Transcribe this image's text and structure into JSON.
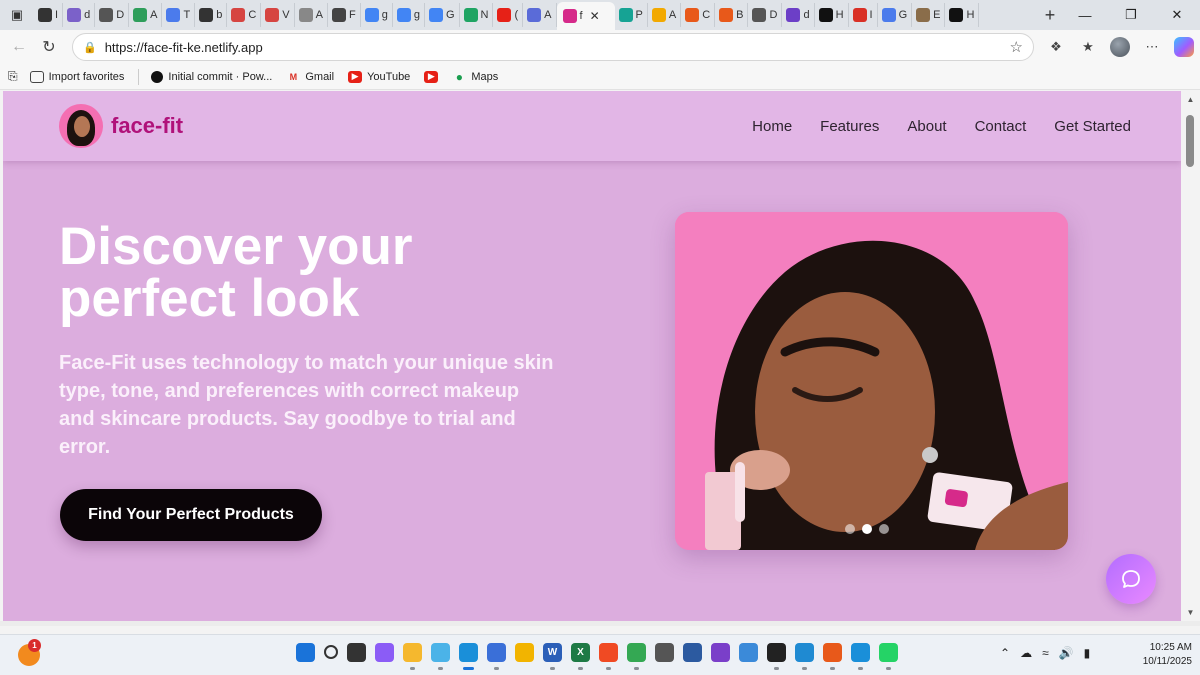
{
  "browser": {
    "active_tab": {
      "title": "f",
      "favicon_color": "#d62a8a"
    },
    "tab_favicons": [
      {
        "label": "I",
        "color": "#333333",
        "icon": "github-icon"
      },
      {
        "label": "d",
        "color": "#7b61c9",
        "icon": "doc-icon"
      },
      {
        "label": "D",
        "color": "#555555",
        "icon": "sparkle-icon"
      },
      {
        "label": "A",
        "color": "#2e9e5b",
        "icon": "sheet-icon"
      },
      {
        "label": "T",
        "color": "#4b7bec",
        "icon": "docs-icon"
      },
      {
        "label": "b",
        "color": "#333333",
        "icon": "github-icon"
      },
      {
        "label": "C",
        "color": "#d64541",
        "icon": "pdf-icon"
      },
      {
        "label": "V",
        "color": "#d64541",
        "icon": "pdf-icon"
      },
      {
        "label": "A",
        "color": "#888888",
        "icon": "globe-icon"
      },
      {
        "label": "F",
        "color": "#444444",
        "icon": "openai-icon"
      },
      {
        "label": "g",
        "color": "#4285f4",
        "icon": "search-icon"
      },
      {
        "label": "g",
        "color": "#4285f4",
        "icon": "search-icon"
      },
      {
        "label": "G",
        "color": "#4285f4",
        "icon": "google-icon"
      },
      {
        "label": "N",
        "color": "#1fa463",
        "icon": "drive-icon"
      },
      {
        "label": "(",
        "color": "#e62117",
        "icon": "youtube-icon"
      },
      {
        "label": "A",
        "color": "#5a6bd8",
        "icon": "check-icon"
      },
      {
        "label": "P",
        "color": "#16a394",
        "icon": "diamond-icon"
      },
      {
        "label": "A",
        "color": "#f2a900",
        "icon": "chart-icon"
      },
      {
        "label": "C",
        "color": "#e8591a",
        "icon": "flame-icon"
      },
      {
        "label": "B",
        "color": "#e8591a",
        "icon": "bolt-icon"
      },
      {
        "label": "D",
        "color": "#555555",
        "icon": "pen-icon"
      },
      {
        "label": "d",
        "color": "#6c3fc7",
        "icon": "list-icon"
      },
      {
        "label": "H",
        "color": "#111111",
        "icon": "x-icon"
      },
      {
        "label": "I",
        "color": "#d93025",
        "icon": "gmail-icon"
      },
      {
        "label": "G",
        "color": "#4b7bec",
        "icon": "gem-icon"
      },
      {
        "label": "E",
        "color": "#8a6d4a",
        "icon": "photo-icon"
      },
      {
        "label": "H",
        "color": "#111111",
        "icon": "x-icon"
      }
    ],
    "url": "https://face-fit-ke.netlify.app",
    "bookmarks": [
      {
        "label": "Import favorites",
        "icon": "folder-icon"
      },
      {
        "label": "Initial commit · Pow...",
        "icon": "github-icon"
      },
      {
        "label": "Gmail",
        "icon": "gmail-icon"
      },
      {
        "label": "YouTube",
        "icon": "youtube-icon"
      },
      {
        "label": "",
        "icon": "youtube-icon"
      },
      {
        "label": "Maps",
        "icon": "maps-icon"
      }
    ]
  },
  "site": {
    "brand": "face-fit",
    "nav": [
      "Home",
      "Features",
      "About",
      "Contact",
      "Get Started"
    ],
    "hero": {
      "title_line1": "Discover your",
      "title_line2": "perfect look",
      "description": "Face-Fit uses technology to match your unique skin type, tone, and preferences with correct makeup and skincare products. Say goodbye to trial and error.",
      "cta_label": "Find Your Perfect Products"
    },
    "carousel": {
      "slide_count": 3,
      "active_index": 1
    }
  },
  "taskbar": {
    "weather_badge": "1",
    "apps": [
      {
        "name": "start",
        "color": "#1a73d9",
        "label": ""
      },
      {
        "name": "search",
        "color": "#edf1f6",
        "label": ""
      },
      {
        "name": "task-view",
        "color": "#333333",
        "label": ""
      },
      {
        "name": "copilot",
        "color": "#8b5cf6",
        "label": ""
      },
      {
        "name": "file-explorer",
        "color": "#f5b82e",
        "label": ""
      },
      {
        "name": "photos",
        "color": "#4bb3e8",
        "label": ""
      },
      {
        "name": "edge",
        "color": "#1a8fd9",
        "label": ""
      },
      {
        "name": "store",
        "color": "#3a6fd8",
        "label": ""
      },
      {
        "name": "files",
        "color": "#f2b400",
        "label": ""
      },
      {
        "name": "word",
        "color": "#2b5fb8",
        "label": "W"
      },
      {
        "name": "excel",
        "color": "#1e7a45",
        "label": "X"
      },
      {
        "name": "brave",
        "color": "#f04a23",
        "label": ""
      },
      {
        "name": "chrome",
        "color": "#34a853",
        "label": ""
      },
      {
        "name": "soccer",
        "color": "#555555",
        "label": ""
      },
      {
        "name": "pen",
        "color": "#2c5aa0",
        "label": ""
      },
      {
        "name": "podcast",
        "color": "#7a3fc9",
        "label": ""
      },
      {
        "name": "notepad",
        "color": "#3b8ad9",
        "label": ""
      },
      {
        "name": "terminal",
        "color": "#222222",
        "label": ""
      },
      {
        "name": "vscode",
        "color": "#1f8ad2",
        "label": ""
      },
      {
        "name": "chrome-dev",
        "color": "#e8591a",
        "label": ""
      },
      {
        "name": "edge-dev",
        "color": "#1a8fd9",
        "label": ""
      },
      {
        "name": "whatsapp",
        "color": "#25d366",
        "label": ""
      }
    ],
    "time": "10:25 AM",
    "date": "10/11/2025"
  },
  "colors": {
    "page_bg": "#dcadde",
    "header_bg": "#e2b6e6",
    "brand": "#b0127a",
    "cta_bg": "#0b0508",
    "carousel_bg": "#f47fbf"
  }
}
